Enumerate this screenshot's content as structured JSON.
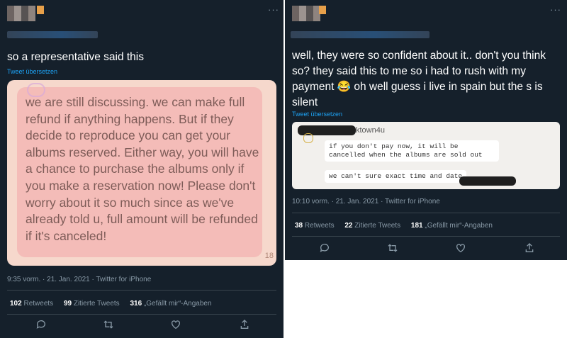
{
  "left": {
    "tweet_text": "so a representative said this",
    "translate_link": "Tweet übersetzen",
    "image_text": "we are still discussing. we can make full refund if anything happens. But if they decide to reproduce you can get your albums reserved. Either way, you will have a chance to purchase the albums only if you make a reservation now! Please don't worry about it so much since as we've already told u, full amount will be refunded if it's canceled!",
    "image_corner_mark": "18",
    "meta": "9:35 vorm. · 21. Jan. 2021 · Twitter for iPhone",
    "stats": {
      "retweets_count": "102",
      "retweets_label": "Retweets",
      "quotes_count": "99",
      "quotes_label": "Zitierte Tweets",
      "likes_count": "316",
      "likes_label": "„Gefällt mir“-Angaben"
    }
  },
  "right": {
    "tweet_text": "well, they were so confident about it.. don't you think so? they said this to me so i had to rush with my payment 😂 oh well guess i live in spain but the s is silent",
    "translate_link": "Tweet übersetzen",
    "image_header": "ktown4u",
    "image_msg_1": "if you don't pay now, it will be cancelled when the albums are sold out",
    "image_msg_2": "we can't sure exact time and date",
    "meta": "10:10 vorm. · 21. Jan. 2021 · Twitter for iPhone",
    "stats": {
      "retweets_count": "38",
      "retweets_label": "Retweets",
      "quotes_count": "22",
      "quotes_label": "Zitierte Tweets",
      "likes_count": "181",
      "likes_label": "„Gefällt mir“-Angaben"
    }
  },
  "more_glyph": "···",
  "icons": [
    "reply-icon",
    "retweet-icon",
    "like-icon",
    "share-icon"
  ],
  "colors": {
    "background": "#15202b",
    "accent": "#1da1f2",
    "muted": "#8899a6"
  }
}
